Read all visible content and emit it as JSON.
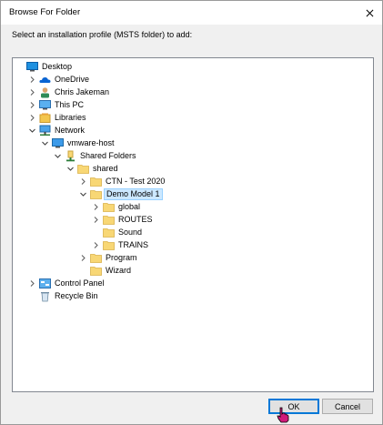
{
  "window": {
    "title": "Browse For Folder"
  },
  "instruction": "Select an installation profile (MSTS folder) to add:",
  "tree": [
    {
      "label": "Desktop",
      "icon": "desktop-icon",
      "depth": 0,
      "expander": "none"
    },
    {
      "label": "OneDrive",
      "icon": "onedrive-icon",
      "depth": 1,
      "expander": "collapsed"
    },
    {
      "label": "Chris Jakeman",
      "icon": "user-icon",
      "depth": 1,
      "expander": "collapsed"
    },
    {
      "label": "This PC",
      "icon": "this-pc-icon",
      "depth": 1,
      "expander": "collapsed"
    },
    {
      "label": "Libraries",
      "icon": "libraries-icon",
      "depth": 1,
      "expander": "collapsed"
    },
    {
      "label": "Network",
      "icon": "network-icon",
      "depth": 1,
      "expander": "expanded"
    },
    {
      "label": "vmware-host",
      "icon": "computer-icon",
      "depth": 2,
      "expander": "expanded"
    },
    {
      "label": "Shared Folders",
      "icon": "share-icon",
      "depth": 3,
      "expander": "expanded"
    },
    {
      "label": "shared",
      "icon": "folder-icon",
      "depth": 4,
      "expander": "expanded"
    },
    {
      "label": "CTN - Test 2020",
      "icon": "folder-icon",
      "depth": 5,
      "expander": "collapsed"
    },
    {
      "label": "Demo Model 1",
      "icon": "folder-icon",
      "depth": 5,
      "expander": "expanded",
      "selected": true
    },
    {
      "label": "global",
      "icon": "folder-icon",
      "depth": 6,
      "expander": "collapsed"
    },
    {
      "label": "ROUTES",
      "icon": "folder-icon",
      "depth": 6,
      "expander": "collapsed"
    },
    {
      "label": "Sound",
      "icon": "folder-icon",
      "depth": 6,
      "expander": "none"
    },
    {
      "label": "TRAINS",
      "icon": "folder-icon",
      "depth": 6,
      "expander": "collapsed"
    },
    {
      "label": "Program",
      "icon": "folder-icon",
      "depth": 5,
      "expander": "collapsed"
    },
    {
      "label": "Wizard",
      "icon": "folder-icon",
      "depth": 5,
      "expander": "none"
    },
    {
      "label": "Control Panel",
      "icon": "control-panel-icon",
      "depth": 1,
      "expander": "collapsed"
    },
    {
      "label": "Recycle Bin",
      "icon": "recycle-bin-icon",
      "depth": 1,
      "expander": "none"
    }
  ],
  "buttons": {
    "ok": "OK",
    "cancel": "Cancel"
  },
  "colors": {
    "selection_bg": "#cce8ff",
    "selection_border": "#99d1ff",
    "default_button_border": "#0078d7",
    "folder_yellow": "#f8d775"
  }
}
